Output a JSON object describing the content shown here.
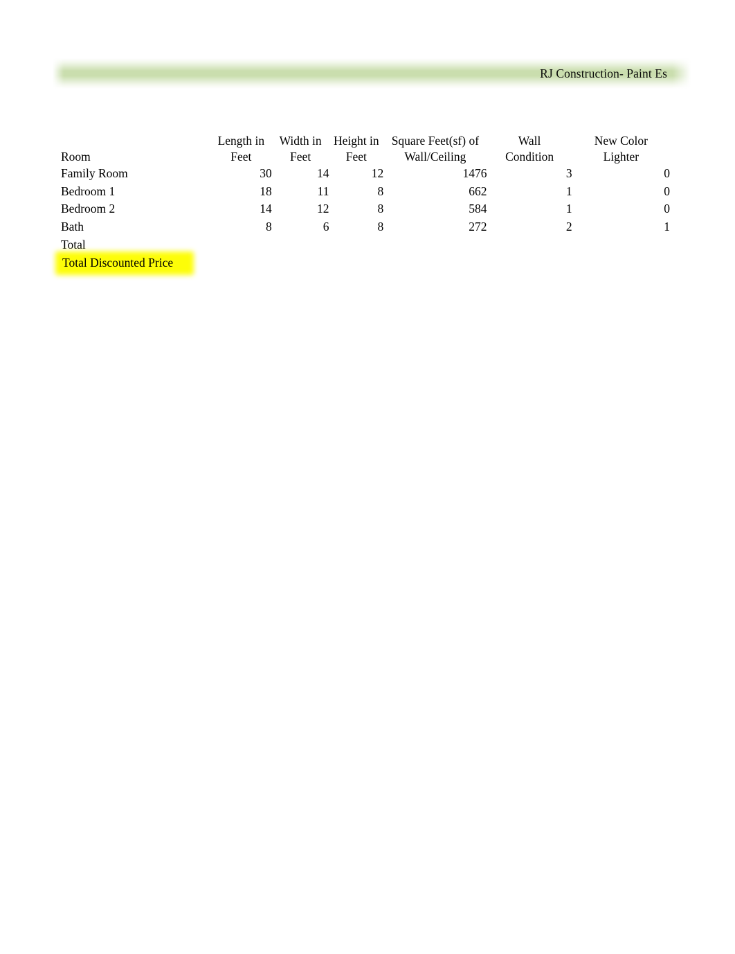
{
  "document": {
    "header": {
      "title": "RJ Construction- Paint Es",
      "banner_color": "#cadeae"
    },
    "highlight_color": "#fdfd08"
  },
  "table": {
    "columns": [
      {
        "key": "room",
        "label_line1": "",
        "label_line2": "Room"
      },
      {
        "key": "length",
        "label_line1": "Length in",
        "label_line2": "Feet"
      },
      {
        "key": "width",
        "label_line1": "Width in",
        "label_line2": "Feet"
      },
      {
        "key": "height",
        "label_line1": "Height in",
        "label_line2": "Feet"
      },
      {
        "key": "sqft",
        "label_line1": "Square Feet(sf) of",
        "label_line2": "Wall/Ceiling"
      },
      {
        "key": "condition",
        "label_line1": "Wall",
        "label_line2": "Condition"
      },
      {
        "key": "newcolor",
        "label_line1": "New Color",
        "label_line2": "Lighter"
      }
    ],
    "rows": [
      {
        "room": "Family Room",
        "length": "30",
        "width": "14",
        "height": "12",
        "sqft": "1476",
        "condition": "3",
        "newcolor": "0"
      },
      {
        "room": "Bedroom 1",
        "length": "18",
        "width": "11",
        "height": "8",
        "sqft": "662",
        "condition": "1",
        "newcolor": "0"
      },
      {
        "room": "Bedroom 2",
        "length": "14",
        "width": "12",
        "height": "8",
        "sqft": "584",
        "condition": "1",
        "newcolor": "0"
      },
      {
        "room": "Bath",
        "length": "8",
        "width": "6",
        "height": "8",
        "sqft": "272",
        "condition": "2",
        "newcolor": "1"
      }
    ],
    "summary_rows": [
      {
        "label": "Total",
        "highlighted": false,
        "length": "",
        "width": "",
        "height": "",
        "sqft": "",
        "condition": "",
        "newcolor": ""
      },
      {
        "label": "Total Discounted Price",
        "highlighted": true,
        "length": "",
        "width": "",
        "height": "",
        "sqft": "",
        "condition": "",
        "newcolor": ""
      }
    ]
  }
}
